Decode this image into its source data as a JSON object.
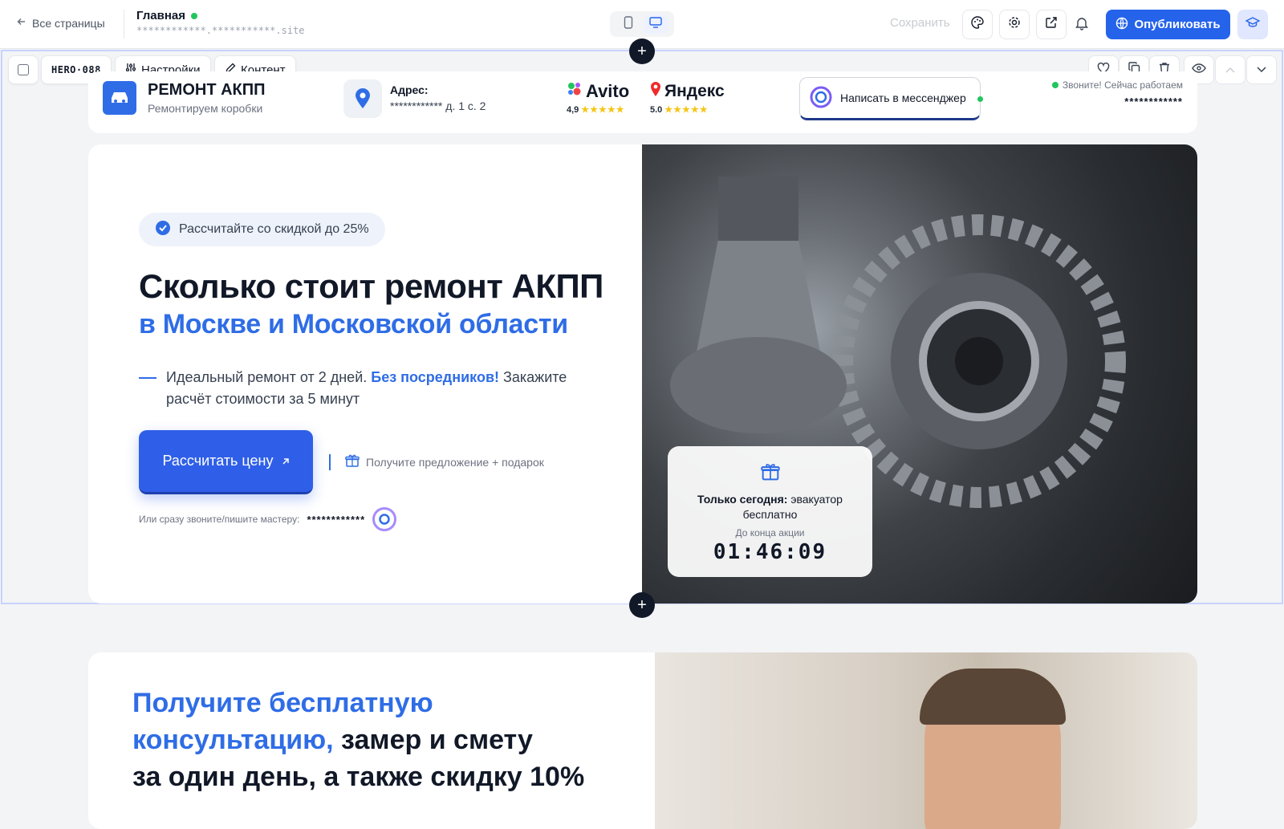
{
  "topbar": {
    "back_label": "Все страницы",
    "page_title": "Главная",
    "page_url": "************.***********.site",
    "save_label": "Сохранить",
    "publish_label": "Опубликовать"
  },
  "section_toolbar": {
    "tag": "HERO·088",
    "settings_label": "Настройки",
    "content_label": "Контент"
  },
  "header": {
    "brand": "РЕМОНТ АКПП",
    "brand_sub": "Ремонтируем коробки",
    "address_label": "Адрес:",
    "address_value": "************ д. 1 с. 2",
    "ratings": [
      {
        "name": "Avito",
        "value": "4,9"
      },
      {
        "name": "Яндекс",
        "value": "5.0"
      }
    ],
    "messenger_label": "Написать в мессенджер",
    "call_note": "Звоните! Сейчас работаем",
    "phone": "************"
  },
  "hero": {
    "badge": "Рассчитайте со скидкой до 25%",
    "title_line1": "Сколько стоит ремонт АКПП",
    "title_line2": "в Москве и Московской области",
    "desc_part1": "Идеальный ремонт от 2 дней. ",
    "desc_highlight": "Без посредников!",
    "desc_part2": " Закажите расчёт стоимости за 5 минут",
    "cta_label": "Рассчитать цену",
    "gift_note": "Получите предложение + подарок",
    "call_label": "Или сразу звоните/пишите мастеру:",
    "call_phone": "************",
    "promo": {
      "title_bold": "Только сегодня:",
      "title_rest": " эвакуатор бесплатно",
      "subtitle": "До конца акции",
      "countdown": "01:46:09"
    }
  },
  "section2": {
    "title_blue": "Получите бесплатную консультацию,",
    "title_dark1": " замер и смету",
    "title_dark2": "за один день, а также скидку 10%"
  },
  "colors": {
    "accent": "#2563eb",
    "brand_blue": "#2f6de6",
    "online": "#22c55e"
  }
}
